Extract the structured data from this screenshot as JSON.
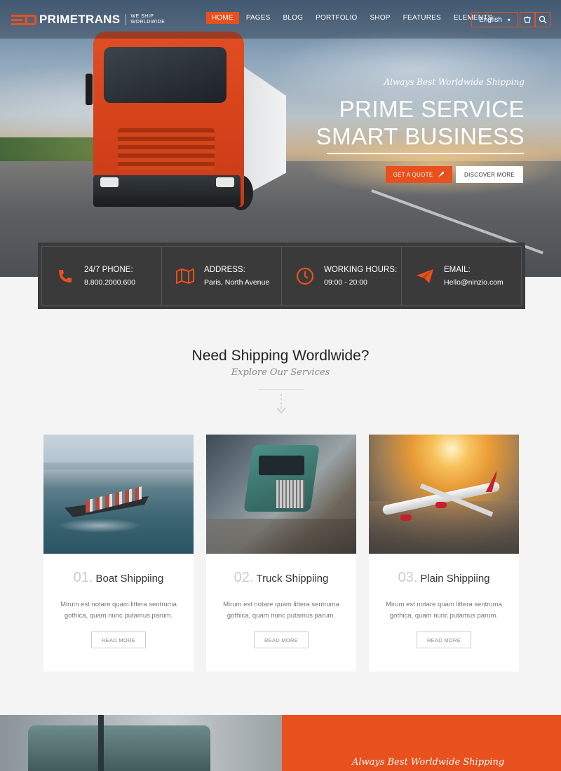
{
  "brand": {
    "name": "PRIMETRANS",
    "tagline_line1": "WE SHIP",
    "tagline_line2": "WORLDWIDE",
    "accent": "#e8501d"
  },
  "nav": {
    "items": [
      "HOME",
      "PAGES",
      "BLOG",
      "PORTFOLIO",
      "SHOP",
      "FEATURES",
      "ELEMENTS"
    ],
    "active": "HOME"
  },
  "language": {
    "selected": "English"
  },
  "icons": {
    "cart": "cart-icon",
    "search": "search-icon",
    "phone": "phone-icon",
    "map": "map-icon",
    "clock": "clock-icon",
    "email": "paper-plane-icon"
  },
  "hero": {
    "kicker": "Always Best Worldwide Shipping",
    "title_line1": "PRIME SERVICE",
    "title_line2": "SMART BUSINESS",
    "cta_primary": "GET A QUOTE",
    "cta_secondary": "DISCOVER MORE"
  },
  "contact": [
    {
      "label": "24/7 PHONE:",
      "value": "8.800.2000.600"
    },
    {
      "label": "ADDRESS:",
      "value": "Paris, North Avenue"
    },
    {
      "label": "WORKING HOURS:",
      "value": "09:00 - 20:00"
    },
    {
      "label": "EMAIL:",
      "value": "Hello@ninzio.com"
    }
  ],
  "services": {
    "title": "Need Shipping Wordlwide?",
    "subtitle": "Explore Our Services",
    "cards": [
      {
        "num": "01.",
        "title": "Boat Shippiing",
        "desc": "Mirum est notare quam littera sentruma gothica, quam nunc putamus parum.",
        "button": "READ MORE"
      },
      {
        "num": "02.",
        "title": "Truck Shippiing",
        "desc": "Mirum est notare quam littera sentruma gothica, quam nunc putamus parum.",
        "button": "READ MORE"
      },
      {
        "num": "03.",
        "title": "Plain Shippiing",
        "desc": "Mirum est notare quam littera sentruma gothica, quam nunc putamus parum.",
        "button": "READ MORE"
      }
    ]
  },
  "bottom": {
    "kicker": "Always Best Worldwide Shipping"
  }
}
